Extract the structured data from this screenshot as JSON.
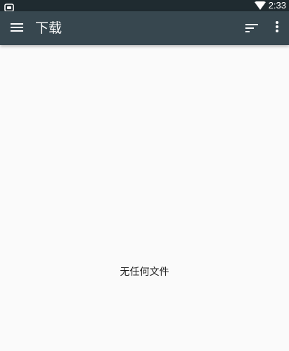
{
  "status_bar": {
    "time": "2:33",
    "left_icon": "notification-app-icon",
    "wifi_icon": "wifi-icon"
  },
  "app_bar": {
    "title": "下载",
    "menu_icon": "hamburger-menu-icon",
    "sort_icon": "sort-icon",
    "more_icon": "more-vert-icon",
    "background_color": "#37474f"
  },
  "content": {
    "empty_message": "无任何文件"
  }
}
